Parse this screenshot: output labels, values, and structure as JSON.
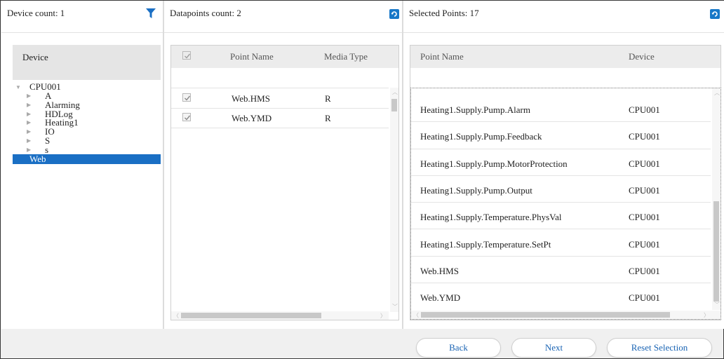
{
  "device_panel": {
    "count_label": "Device count: 1",
    "header": "Device",
    "tree": [
      {
        "label": "CPU001",
        "expanded": true,
        "level": 0
      },
      {
        "label": "A",
        "level": 1
      },
      {
        "label": "Alarming",
        "level": 1
      },
      {
        "label": "HDLog",
        "level": 1
      },
      {
        "label": "Heating1",
        "level": 1
      },
      {
        "label": "IO",
        "level": 1
      },
      {
        "label": "S",
        "level": 1
      },
      {
        "label": "s",
        "level": 1
      },
      {
        "label": "Web",
        "level": 1,
        "selected": true
      }
    ]
  },
  "datapoints_panel": {
    "count_label": "Datapoints count: 2",
    "columns": [
      "Point Name",
      "Media Type"
    ],
    "rows": [
      {
        "checked": true,
        "point_name": "Web.HMS",
        "media_type": "R"
      },
      {
        "checked": true,
        "point_name": "Web.YMD",
        "media_type": "R"
      }
    ]
  },
  "selected_panel": {
    "count_label": "Selected Points: 17",
    "columns": [
      "Point Name",
      "Device"
    ],
    "rows": [
      {
        "point_name": "Heating1.Supply.Pump.Alarm",
        "device": "CPU001"
      },
      {
        "point_name": "Heating1.Supply.Pump.Feedback",
        "device": "CPU001"
      },
      {
        "point_name": "Heating1.Supply.Pump.MotorProtection",
        "device": "CPU001"
      },
      {
        "point_name": "Heating1.Supply.Pump.Output",
        "device": "CPU001"
      },
      {
        "point_name": "Heating1.Supply.Temperature.PhysVal",
        "device": "CPU001"
      },
      {
        "point_name": "Heating1.Supply.Temperature.SetPt",
        "device": "CPU001"
      },
      {
        "point_name": "Web.HMS",
        "device": "CPU001"
      },
      {
        "point_name": "Web.YMD",
        "device": "CPU001"
      }
    ]
  },
  "footer": {
    "back_label": "Back",
    "next_label": "Next",
    "reset_label": "Reset Selection"
  },
  "colors": {
    "accent": "#1a6fc4",
    "link": "#1a64b4",
    "selection_bg": "#1a6fc4"
  },
  "icons": [
    "filter-icon",
    "refresh-icon",
    "tree-expanded-arrow",
    "tree-collapsed-arrow",
    "checkbox-check"
  ]
}
